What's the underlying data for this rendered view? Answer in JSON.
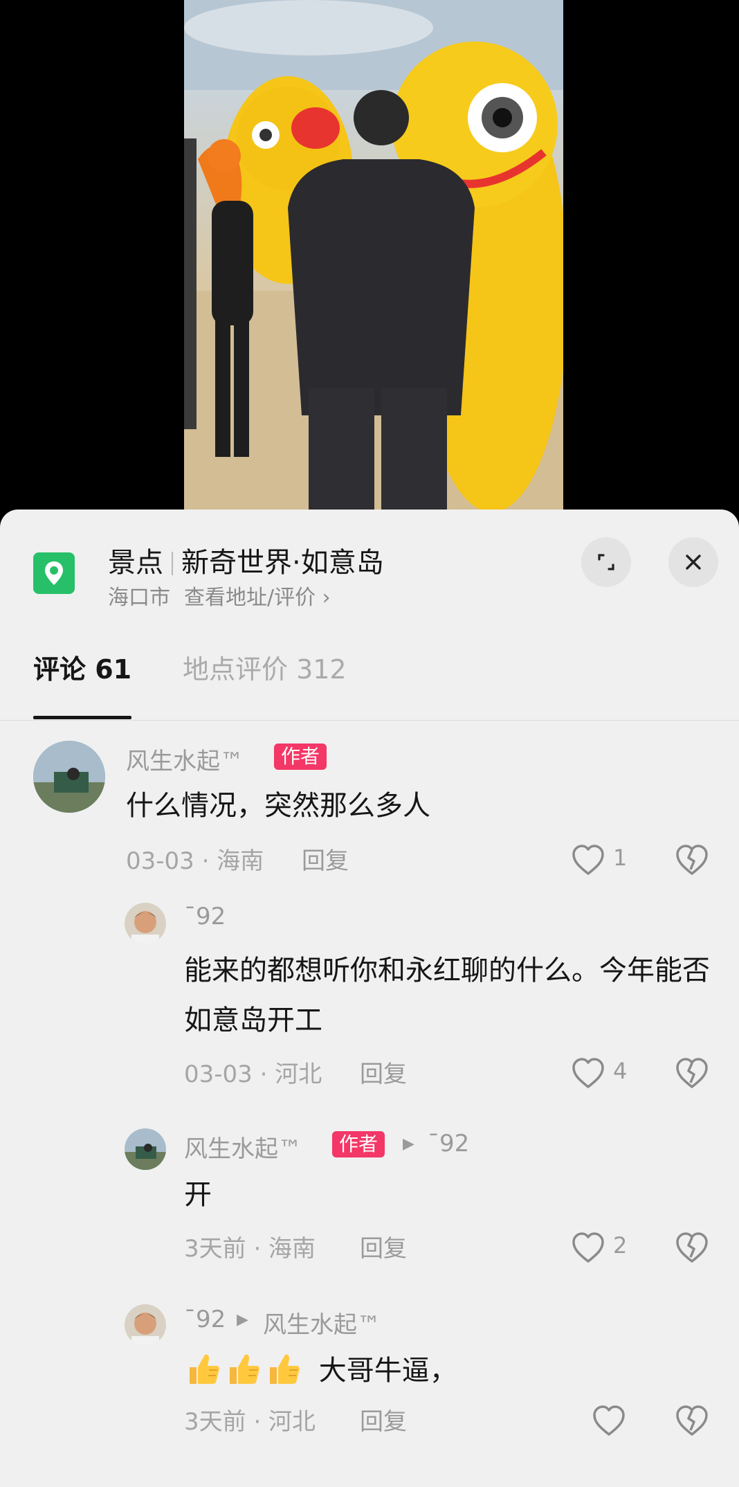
{
  "location": {
    "category": "景点",
    "name": "新奇世界·如意岛",
    "city": "海口市",
    "link_text": "查看地址/评价 ›",
    "icon": "map-pin-icon",
    "accent_color": "#27c069"
  },
  "controls": {
    "expand_icon": "expand-icon",
    "close_icon": "close-icon"
  },
  "tabs": [
    {
      "label": "评论 61",
      "active": true
    },
    {
      "label": "地点评价 312",
      "active": false
    }
  ],
  "author_badge": "作者",
  "badge_color": "#f33766",
  "reply_label": "回复",
  "comments": [
    {
      "user": "风生水起™",
      "is_author": true,
      "text": "什么情况，突然那么多人",
      "meta": "03-03 · 海南",
      "likes": "1"
    },
    {
      "user": "ˉ92",
      "is_author": false,
      "text": "能来的都想听你和永红聊的什么。今年能否如意岛开工",
      "meta": "03-03 · 河北",
      "likes": "4"
    },
    {
      "user": "风生水起™",
      "is_author": true,
      "reply_to": "ˉ92",
      "text": "开",
      "meta": "3天前 · 海南",
      "likes": "2"
    },
    {
      "user": "ˉ92",
      "is_author": false,
      "reply_to": "风生水起™",
      "text": "大哥牛逼，",
      "emoji": "👍👍👍",
      "meta": "3天前 · 河北",
      "likes": ""
    }
  ]
}
